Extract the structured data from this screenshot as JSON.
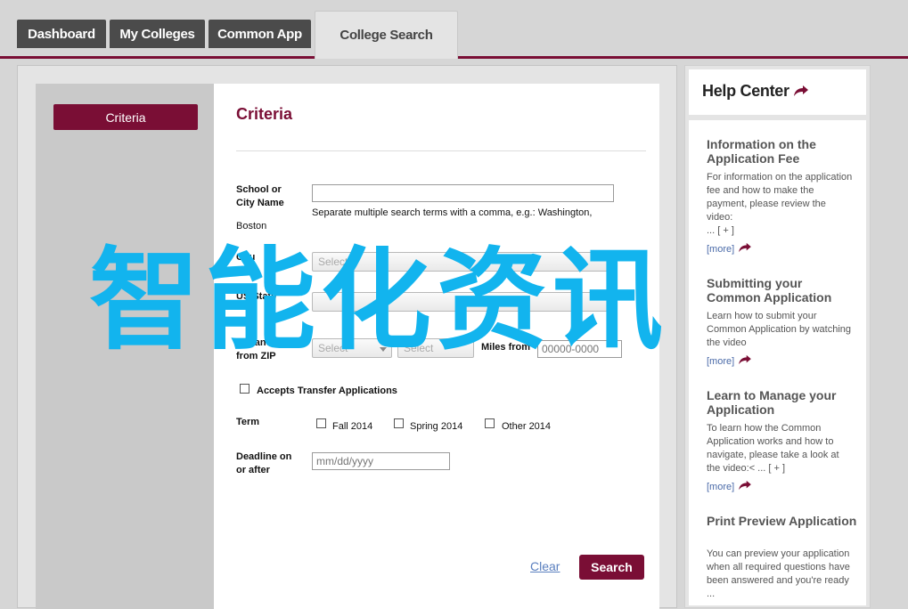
{
  "nav": {
    "tabs": [
      "Dashboard",
      "My Colleges",
      "Common App",
      "College Search"
    ],
    "active": "College Search"
  },
  "sidebar": {
    "criteria_button": "Criteria"
  },
  "form": {
    "heading": "Criteria",
    "school_label_1": "School or",
    "school_label_2": "City Name",
    "school_value": "",
    "school_hint": "Separate multiple search terms with a comma, e.g.: Washington,",
    "school_hint_2": "Boston",
    "country_label": "Cou",
    "country_placeholder": "Select",
    "state_label": "US State",
    "distance_label_1": "Distance",
    "distance_label_2": "from ZIP",
    "distance_select": "Select",
    "distance_select_2": "Select",
    "miles_label": "Miles from",
    "zip_placeholder": "00000-0000",
    "transfer_label": "Accepts Transfer Applications",
    "term_label": "Term",
    "terms": [
      "Fall 2014",
      "Spring 2014",
      "Other 2014"
    ],
    "deadline_label_1": "Deadline on",
    "deadline_label_2": "or after",
    "deadline_placeholder": "mm/dd/yyyy",
    "clear_label": "Clear",
    "search_label": "Search"
  },
  "help": {
    "title": "Help Center",
    "items": [
      {
        "title": "Information on the Application Fee",
        "text": "For information on the application fee and how to make the payment, please review the video:",
        "ellipsis": "... [ + ]",
        "more": "[more]"
      },
      {
        "title": "Submitting your Common Application",
        "text": "Learn how to submit your Common Application by watching the video",
        "more": "[more]"
      },
      {
        "title": "Learn to Manage your Application",
        "text": "To learn how the Common Application works and how to navigate, please take a look at the video:< ... [ + ]",
        "more": "[more]"
      },
      {
        "title": "Print Preview Application",
        "text": "You can preview your application when all required questions have been answered and you're ready ..."
      }
    ]
  },
  "watermark": "智能化资讯",
  "colors": {
    "brand": "#7a0e35",
    "watermark": "#12b4ee",
    "tab_dark": "#4b4b4b"
  }
}
